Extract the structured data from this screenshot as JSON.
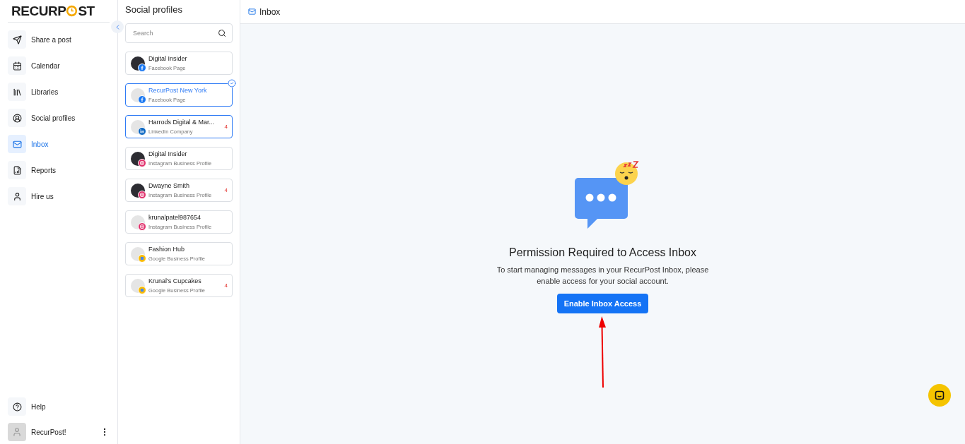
{
  "logo": {
    "before": "RECURP",
    "after": "ST"
  },
  "nav": [
    {
      "label": "Share a post",
      "selected": false
    },
    {
      "label": "Calendar",
      "selected": false
    },
    {
      "label": "Libraries",
      "selected": false
    },
    {
      "label": "Social profiles",
      "selected": false
    },
    {
      "label": "Inbox",
      "selected": true
    },
    {
      "label": "Reports",
      "selected": false
    },
    {
      "label": "Hire us",
      "selected": false
    }
  ],
  "help": {
    "label": "Help"
  },
  "account": {
    "name": "RecurPost!"
  },
  "profiles_panel": {
    "title": "Social profiles",
    "search": {
      "placeholder": "Search"
    },
    "profiles": [
      {
        "name": "Digital Insider",
        "type": "Facebook Page",
        "kind": "facebook",
        "has_photo": true,
        "selected": false,
        "checked": false
      },
      {
        "name": "RecurPost New York",
        "type": "Facebook Page",
        "kind": "facebook",
        "has_photo": false,
        "selected": true,
        "checked": true
      },
      {
        "name": "Harrods Digital & Mar...",
        "type": "LinkedIn Company",
        "kind": "linkedin",
        "has_photo": false,
        "selected": true,
        "checked": false,
        "count": "4"
      },
      {
        "name": "Digital Insider",
        "type": "Instagram Business Profile",
        "kind": "instagram",
        "has_photo": true,
        "selected": false,
        "checked": false
      },
      {
        "name": "Dwayne Smith",
        "type": "Instagram Business Profile",
        "kind": "instagram",
        "has_photo": true,
        "selected": false,
        "checked": false,
        "count": "4"
      },
      {
        "name": "krunalpatel987654",
        "type": "Instagram Business Profile",
        "kind": "instagram",
        "has_photo": false,
        "selected": false,
        "checked": false
      },
      {
        "name": "Fashion Hub",
        "type": "Google Business Profile",
        "kind": "google",
        "has_photo": false,
        "selected": false,
        "checked": false
      },
      {
        "name": "Krunal's Cupcakes",
        "type": "Google Business Profile",
        "kind": "google",
        "has_photo": false,
        "selected": false,
        "checked": false,
        "count": "4"
      }
    ]
  },
  "header": {
    "title": "Inbox"
  },
  "empty_state": {
    "title": "Permission Required to Access Inbox",
    "message": "To start managing messages in your RecurPost Inbox, please enable access for your social account.",
    "button": "Enable Inbox Access"
  }
}
